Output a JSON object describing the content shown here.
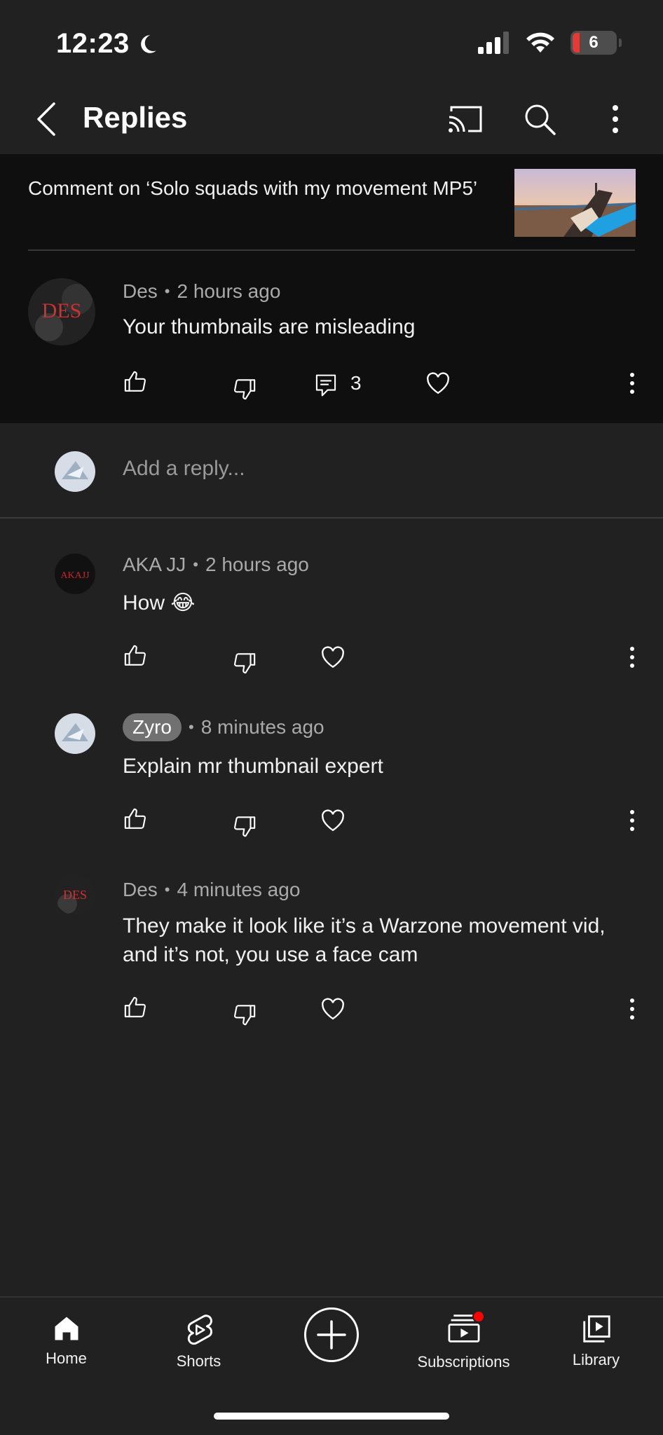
{
  "status_bar": {
    "time": "12:23",
    "battery": "6"
  },
  "header": {
    "title": "Replies"
  },
  "context": {
    "text": "Comment on ‘Solo squads with my movement MP5’"
  },
  "parent_comment": {
    "author": "Des",
    "time": "2 hours ago",
    "text": "Your thumbnails are misleading",
    "reply_count": "3",
    "avatar_text": "DES"
  },
  "reply_box": {
    "placeholder": "Add a reply..."
  },
  "replies": [
    {
      "author": "AKA JJ",
      "time": "2 hours ago",
      "text": "How 😂",
      "avatar_text": "AKAJJ"
    },
    {
      "author": "Zyro",
      "time": "8 minutes ago",
      "text": "Explain mr thumbnail expert",
      "is_creator": true
    },
    {
      "author": "Des",
      "time": "4 minutes ago",
      "text": "They make it look like it’s a Warzone movement vid, and it’s not, you use a face cam",
      "avatar_text": "DES"
    }
  ],
  "bottom_nav": {
    "home": "Home",
    "shorts": "Shorts",
    "subscriptions": "Subscriptions",
    "library": "Library"
  },
  "colors": {
    "background": "#212121",
    "panel": "#0f0f0f",
    "accent_red": "#ff0000",
    "meta_gray": "#aaaaaa"
  },
  "icons": [
    "back-icon",
    "cast-icon",
    "search-icon",
    "more-vert-icon",
    "like-icon",
    "dislike-icon",
    "reply-icon",
    "heart-icon",
    "home-icon",
    "shorts-icon",
    "create-icon",
    "subscriptions-icon",
    "library-icon"
  ]
}
